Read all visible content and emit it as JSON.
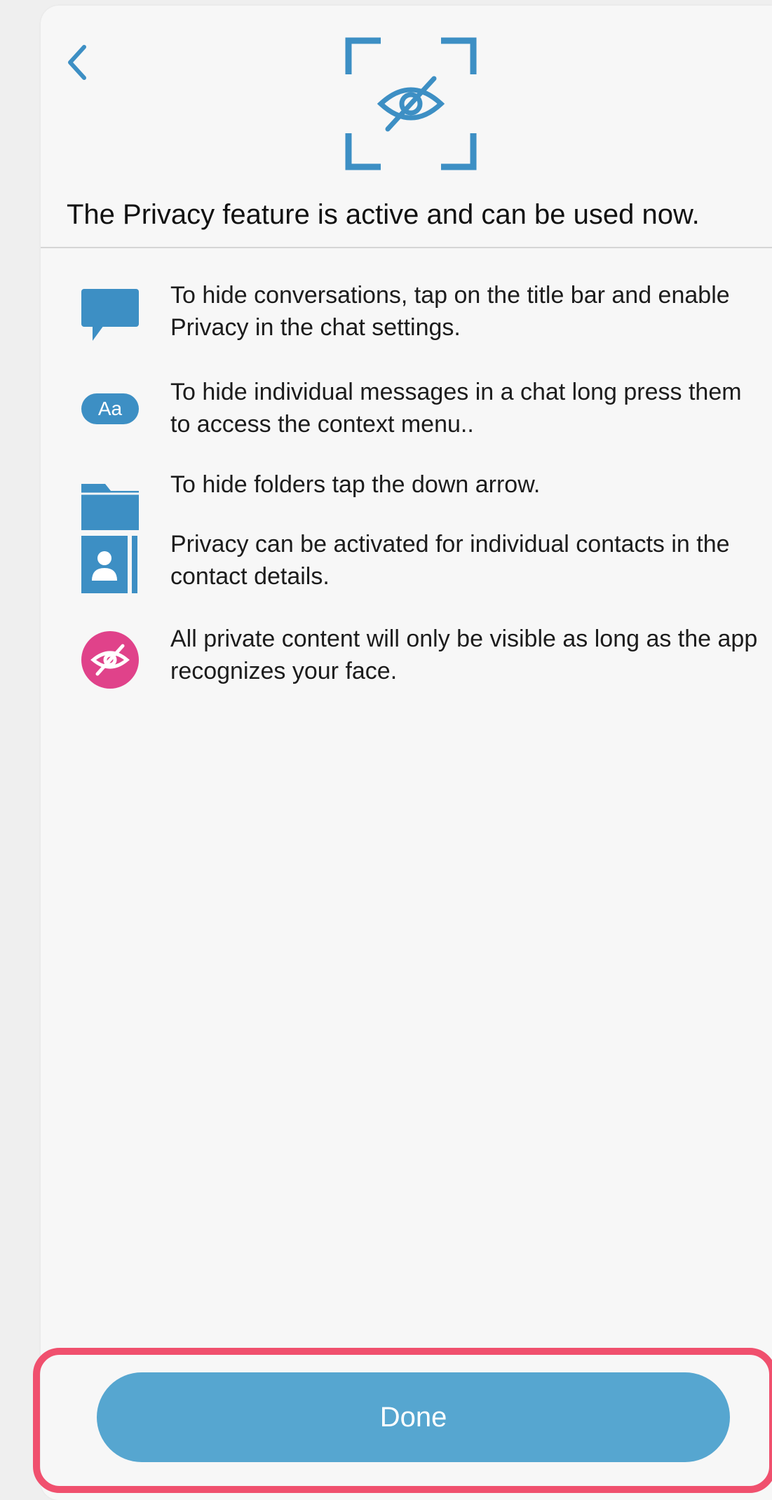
{
  "nav": {
    "back_icon": "chevron-left-icon"
  },
  "hero": {
    "icon": "privacy-face-scan-icon"
  },
  "headline": "The Privacy feature is active and can be used now.",
  "instructions": [
    {
      "icon": "chat-bubble-icon",
      "text": "To hide conversations, tap on the title bar and enable Privacy in the chat settings."
    },
    {
      "icon": "text-message-icon",
      "icon_label": "Aa",
      "text": "To hide individual messages in a chat long press them to access the context menu.."
    },
    {
      "icon": "folder-icon",
      "text": "To hide folders tap the down arrow."
    },
    {
      "icon": "contact-card-icon",
      "text": "Privacy can be activated for individual contacts in the contact details."
    },
    {
      "icon": "eye-slash-icon",
      "text": "All private content will only be visible as long as the app recognizes your face."
    }
  ],
  "footer": {
    "done_label": "Done"
  },
  "colors": {
    "accent": "#56a6d0",
    "icon_blue": "#3d8fc4",
    "privacy_pink": "#e0428a",
    "highlight": "#f0506e"
  }
}
